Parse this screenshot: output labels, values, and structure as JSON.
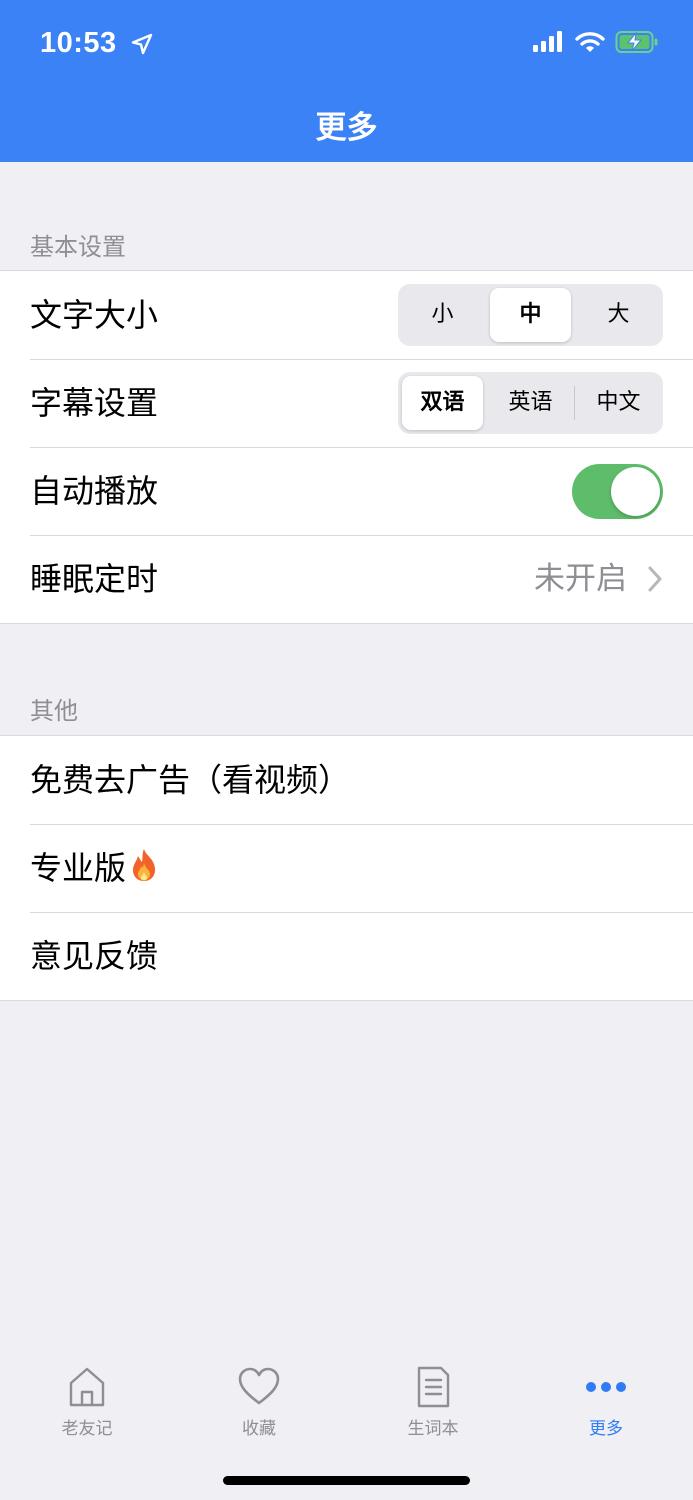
{
  "status_bar": {
    "time": "10:53"
  },
  "nav": {
    "title": "更多"
  },
  "sections": {
    "basic": {
      "label": "基本设置",
      "font_size": {
        "label": "文字大小",
        "options": [
          "小",
          "中",
          "大"
        ],
        "selected": "中"
      },
      "subtitle": {
        "label": "字幕设置",
        "options": [
          "双语",
          "英语",
          "中文"
        ],
        "selected": "双语"
      },
      "autoplay": {
        "label": "自动播放",
        "on": true
      },
      "sleep_timer": {
        "label": "睡眠定时",
        "value": "未开启"
      }
    },
    "other": {
      "label": "其他",
      "items": [
        "免费去广告（看视频）",
        "专业版",
        "意见反馈"
      ]
    }
  },
  "tabbar": {
    "items": [
      {
        "label": "老友记",
        "icon": "home-icon",
        "active": false
      },
      {
        "label": "收藏",
        "icon": "heart-icon",
        "active": false
      },
      {
        "label": "生词本",
        "icon": "document-icon",
        "active": false
      },
      {
        "label": "更多",
        "icon": "more-icon",
        "active": true
      }
    ]
  },
  "colors": {
    "header": "#3b82f6",
    "toggle_on": "#5ebd6a",
    "tab_active": "#2f7cf6",
    "background": "#efeff4"
  }
}
